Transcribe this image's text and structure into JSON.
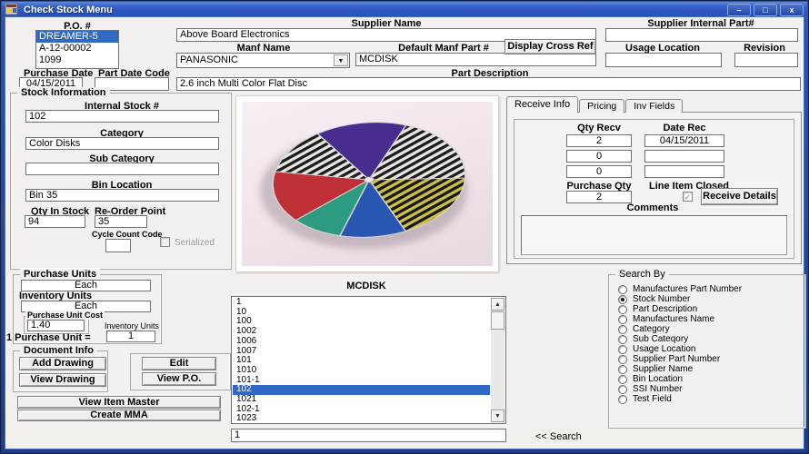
{
  "window": {
    "title": "Check Stock Menu"
  },
  "icons": {
    "minimize": "–",
    "maximize": "□",
    "close": "x",
    "dropdown": "▼",
    "scroll_up": "▲",
    "scroll_down": "▼",
    "check": "✓"
  },
  "header": {
    "po_label": "P.O. #",
    "po_items": [
      "DREAMER-5",
      "A-12-00002",
      "1099"
    ],
    "po_selected_index": 0,
    "supplier_name_label": "Supplier Name",
    "supplier_name_value": "Above Board Electronics",
    "supplier_internal_label": "Supplier Internal Part#",
    "supplier_internal_value": "",
    "manf_name_label": "Manf Name",
    "manf_name_value": "PANASONIC",
    "default_manf_label": "Default Manf Part #",
    "default_manf_value": "MCDISK",
    "display_cross_ref": "Display Cross Ref",
    "usage_location_label": "Usage Location",
    "usage_location_value": "",
    "revision_label": "Revision",
    "revision_value": "",
    "purchase_date_label": "Purchase Date",
    "purchase_date_value": "04/15/2011",
    "part_date_code_label": "Part Date Code",
    "part_date_code_value": "",
    "part_description_label": "Part Description",
    "part_description_value": "2.6 inch Multi Color Flat Disc"
  },
  "stock_info": {
    "title": "Stock Information",
    "internal_stock_label": "Internal Stock #",
    "internal_stock_value": "102",
    "category_label": "Category",
    "category_value": "Color Disks",
    "sub_category_label": "Sub Category",
    "sub_category_value": "",
    "bin_location_label": "Bin Location",
    "bin_location_value": "Bin 35",
    "qty_in_stock_label": "Qty In Stock",
    "qty_in_stock_value": "94",
    "reorder_label": "Re-Order Point",
    "reorder_value": "35",
    "cycle_count_label": "Cycle Count Code",
    "cycle_count_value": "",
    "serialized_label": "Serialized"
  },
  "tabs": {
    "items": [
      "Receive Info",
      "Pricing",
      "Inv Fields"
    ],
    "active": 0
  },
  "receive": {
    "qty_recv_label": "Qty Recv",
    "date_rec_label": "Date Rec",
    "rows": [
      {
        "qty": "2",
        "date": "04/15/2011"
      },
      {
        "qty": "0",
        "date": ""
      },
      {
        "qty": "0",
        "date": ""
      }
    ],
    "purchase_qty_label": "Purchase Qty",
    "purchase_qty_value": "2",
    "line_item_closed_label": "Line Item Closed",
    "line_item_closed_checked": true,
    "receive_details_button": "Receive Details",
    "comments_label": "Comments",
    "comments_value": ""
  },
  "units": {
    "purchase_units_label": "Purchase Units",
    "purchase_units_value": "Each",
    "inventory_units_label": "Inventory Units",
    "inventory_units_value": "Each",
    "purchase_unit_cost_label": "Purchase Unit Cost",
    "purchase_unit_cost_value": "1.40",
    "inv_units_small_label": "Inventory Units",
    "one_purchase_unit_label": "1 Purchase Unit =",
    "one_purchase_unit_value": "1"
  },
  "documents": {
    "title": "Document Info",
    "add_drawing": "Add Drawing",
    "view_drawing": "View Drawing",
    "edit": "Edit",
    "view_po": "View P.O.",
    "view_item_master": "View Item Master",
    "create_mma": "Create MMA"
  },
  "list_section": {
    "title": "MCDISK",
    "items": [
      "1",
      "10",
      "100",
      "1002",
      "1006",
      "1007",
      "101",
      "1010",
      "101-1",
      "102",
      "1021",
      "102-1",
      "1023"
    ],
    "selected_index": 9,
    "filter_value": "1",
    "search_hint": "<< Search"
  },
  "search_by": {
    "title": "Search By",
    "options": [
      "Manufactures Part Number",
      "Stock Number",
      "Part Description",
      "Manufactures Name",
      "Category",
      "Sub Cateqory",
      "Usage Location",
      "Supplier Part Number",
      "Supplier Name",
      "Bin Location",
      "SSI Number",
      "Test Field"
    ],
    "selected_index": 1
  },
  "colors": {
    "selection": "#316ac5",
    "titlebar": "#2e57bc",
    "client_bg": "#f2f1ef"
  }
}
